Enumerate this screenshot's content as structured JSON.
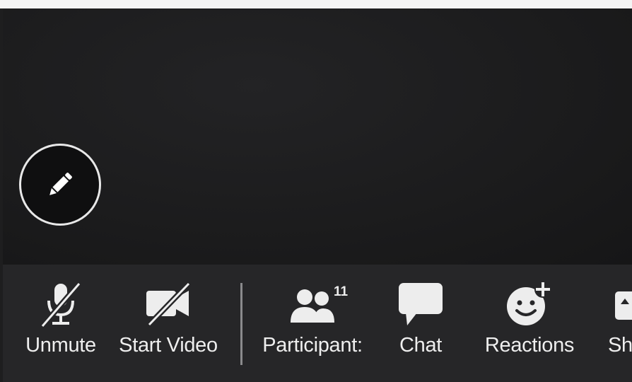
{
  "toolbar": {
    "unmute_label": "Unmute",
    "start_video_label": "Start Video",
    "participants_label": "Participant:",
    "participants_count": "11",
    "chat_label": "Chat",
    "reactions_label": "Reactions",
    "share_label": "Sh"
  },
  "icons": {
    "annotate": "pencil-icon",
    "unmute": "microphone-muted-icon",
    "start_video": "video-camera-off-icon",
    "participants": "participants-icon",
    "chat": "chat-bubble-icon",
    "reactions": "smiley-plus-icon",
    "share": "share-screen-icon"
  },
  "colors": {
    "background": "#1e1e1f",
    "toolbar": "#262628",
    "icon": "#ededed"
  }
}
